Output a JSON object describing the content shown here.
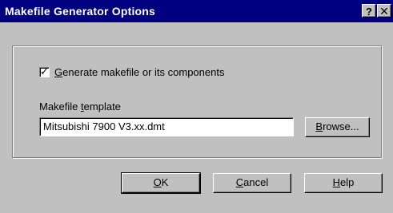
{
  "window": {
    "title": "Makefile Generator Options",
    "help_glyph": "?",
    "close_glyph": "✕"
  },
  "options": {
    "generate_checkbox": {
      "checked": true,
      "mnemonic": "G",
      "label_rest": "enerate makefile or its components"
    },
    "template": {
      "label_prefix": "Makefile ",
      "label_mnemonic": "t",
      "label_rest": "emplate",
      "value": "Mitsubishi 7900 V3.xx.dmt"
    },
    "browse": {
      "mnemonic": "B",
      "label_rest": "rowse..."
    }
  },
  "buttons": {
    "ok": {
      "mnemonic": "O",
      "label_rest": "K"
    },
    "cancel": {
      "mnemonic": "C",
      "label_rest": "ancel"
    },
    "help": {
      "mnemonic": "H",
      "label_rest": "elp"
    }
  }
}
